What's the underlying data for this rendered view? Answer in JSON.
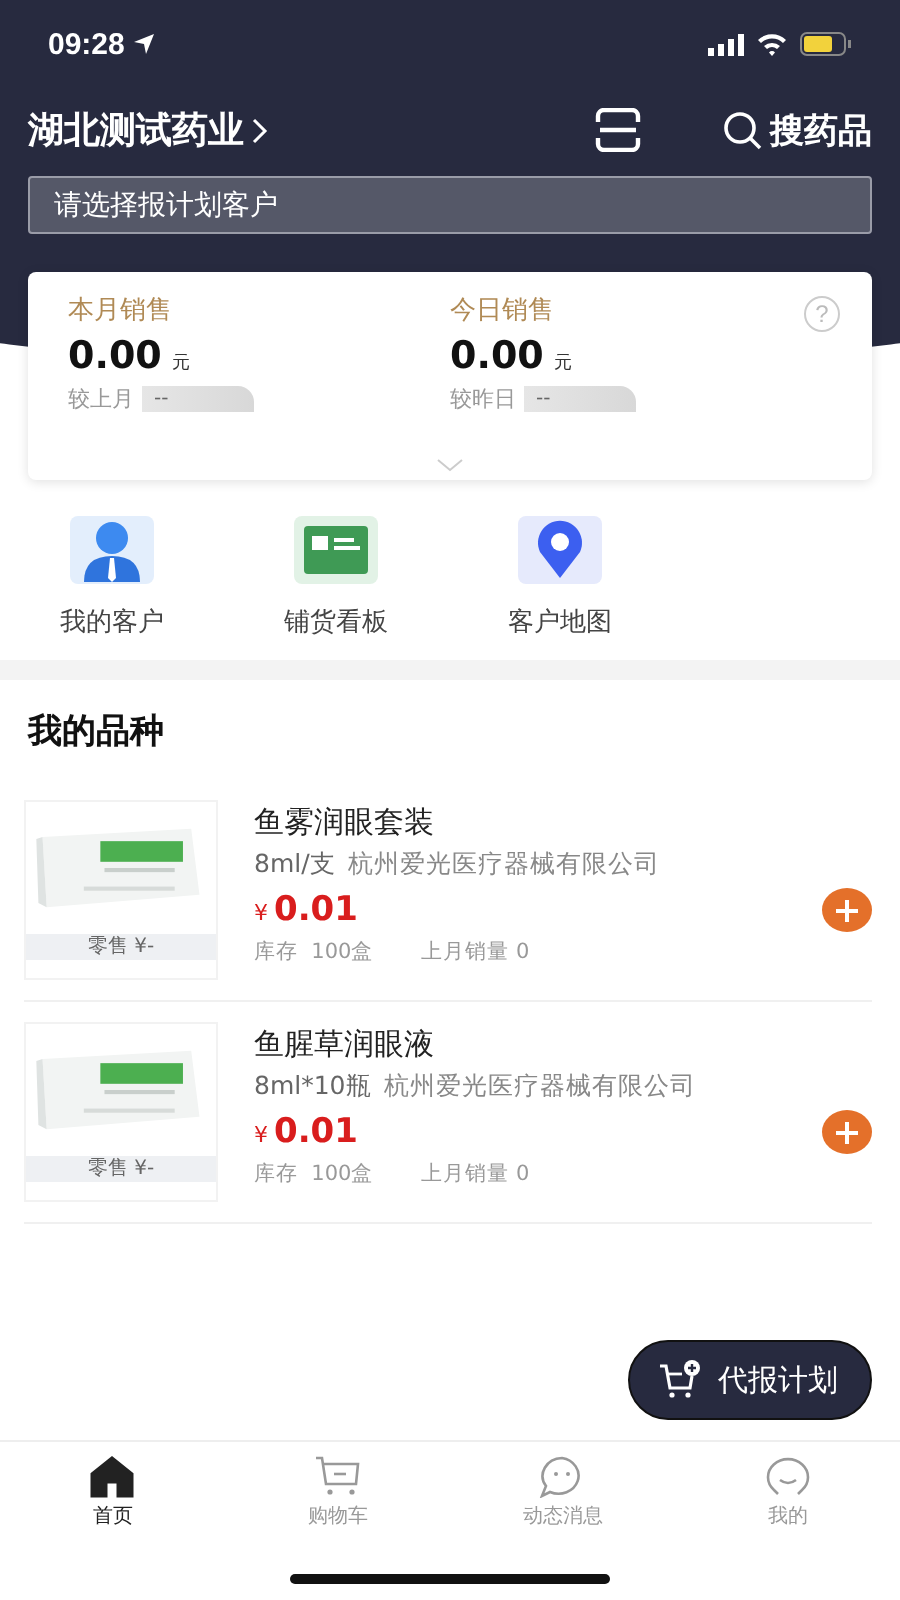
{
  "status_bar": {
    "time": "09:28"
  },
  "header": {
    "company": "湖北测试药业",
    "search_label": "搜药品",
    "customer_field": {
      "placeholder": "请选择报计划客户"
    }
  },
  "sales_card": {
    "stats": [
      {
        "label": "本月销售",
        "value": "0.00",
        "unit": "元",
        "compare_label": "较上月",
        "compare_value": "--"
      },
      {
        "label": "今日销售",
        "value": "0.00",
        "unit": "元",
        "compare_label": "较昨日",
        "compare_value": "--"
      }
    ],
    "help": "?"
  },
  "shortcuts": [
    {
      "label": "我的客户"
    },
    {
      "label": "铺货看板"
    },
    {
      "label": "客户地图"
    }
  ],
  "section_title": "我的品种",
  "products": [
    {
      "kind": "picture",
      "retail": "零售 ¥-",
      "name": "鱼雾润眼套装",
      "spec": "8ml/支",
      "maker": "杭州爱光医疗器械有限公司",
      "currency": "¥",
      "price": "0.01",
      "stock": "库存  100盒",
      "last_month": "上月销量 0"
    },
    {
      "kind": "picture",
      "retail": "零售 ¥-",
      "name": "鱼腥草润眼液",
      "spec": "8ml*10瓶",
      "maker": "杭州爱光医疗器械有限公司",
      "currency": "¥",
      "price": "0.01",
      "stock": "库存  100盒",
      "last_month": "上月销量 0"
    }
  ],
  "fab": {
    "label": "代报计划"
  },
  "tab_bar": [
    {
      "label": "首页",
      "selected": true
    },
    {
      "label": "购物车",
      "selected": false
    },
    {
      "label": "动态消息",
      "selected": false
    },
    {
      "label": "我的",
      "selected": false
    }
  ]
}
